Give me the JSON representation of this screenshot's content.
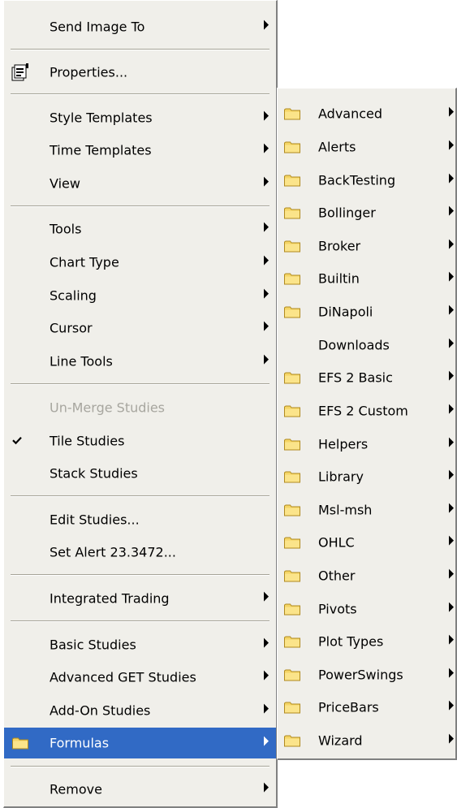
{
  "main_menu": {
    "items": {
      "send_image_to": "Send Image To",
      "properties": "Properties...",
      "style_templates": "Style Templates",
      "time_templates": "Time Templates",
      "view": "View",
      "tools": "Tools",
      "chart_type": "Chart Type",
      "scaling": "Scaling",
      "cursor": "Cursor",
      "line_tools": "Line Tools",
      "unmerge_studies": "Un-Merge Studies",
      "tile_studies": "Tile Studies",
      "stack_studies": "Stack Studies",
      "edit_studies": "Edit Studies...",
      "set_alert": "Set Alert 23.3472...",
      "integrated_trading": "Integrated Trading",
      "basic_studies": "Basic Studies",
      "advanced_get_studies": "Advanced GET Studies",
      "addon_studies": "Add-On Studies",
      "formulas": "Formulas",
      "remove": "Remove"
    },
    "tile_studies_checked": true,
    "highlighted_item": "Formulas"
  },
  "formulas_submenu": {
    "items": [
      "Advanced",
      "Alerts",
      "BackTesting",
      "Bollinger",
      "Broker",
      "Builtin",
      "DiNapoli",
      "Downloads",
      "EFS 2 Basic",
      "EFS 2 Custom",
      "Helpers",
      "Library",
      "Msl-msh",
      "OHLC",
      "Other",
      "Pivots",
      "Plot Types",
      "PowerSwings",
      "PriceBars",
      "Wizard"
    ]
  },
  "colors": {
    "menu_bg": "#f0efea",
    "highlight_bg": "#316ac5",
    "disabled_text": "#a7a69f",
    "folder_fill": "#f5d565"
  },
  "icons": {
    "properties": "properties-icon",
    "check": "checkmark-icon",
    "folder": "folder-icon",
    "submenu": "submenu-arrow-icon"
  }
}
